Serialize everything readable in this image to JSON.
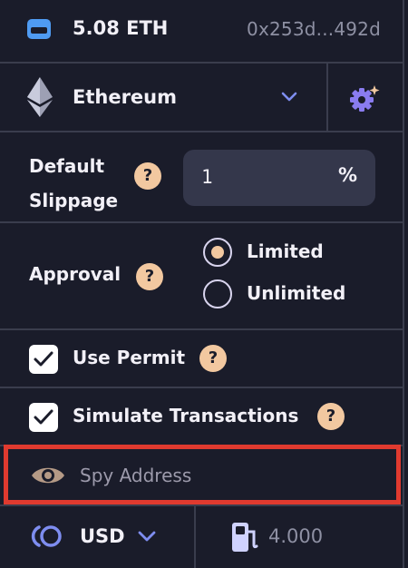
{
  "header": {
    "balance": "5.08 ETH",
    "address": "0x253d...492d"
  },
  "network": {
    "name": "Ethereum"
  },
  "slippage": {
    "label_line1": "Default",
    "label_line2": "Slippage",
    "help": "?",
    "value": "1",
    "unit": "%"
  },
  "approval": {
    "label": "Approval",
    "help": "?",
    "options": [
      {
        "label": "Limited",
        "selected": true
      },
      {
        "label": "Unlimited",
        "selected": false
      }
    ]
  },
  "permit": {
    "label": "Use Permit",
    "checked": true,
    "help": "?"
  },
  "simulate": {
    "label": "Simulate Transactions",
    "checked": true,
    "help": "?"
  },
  "spy": {
    "placeholder": "Spy Address"
  },
  "footer": {
    "currency": "USD",
    "gas_price": "4.000"
  },
  "colors": {
    "background": "#1a1c2a",
    "accent": "#f2c8a0",
    "highlight_border": "#e03a2f",
    "wallet_icon": "#4f9bf2"
  }
}
